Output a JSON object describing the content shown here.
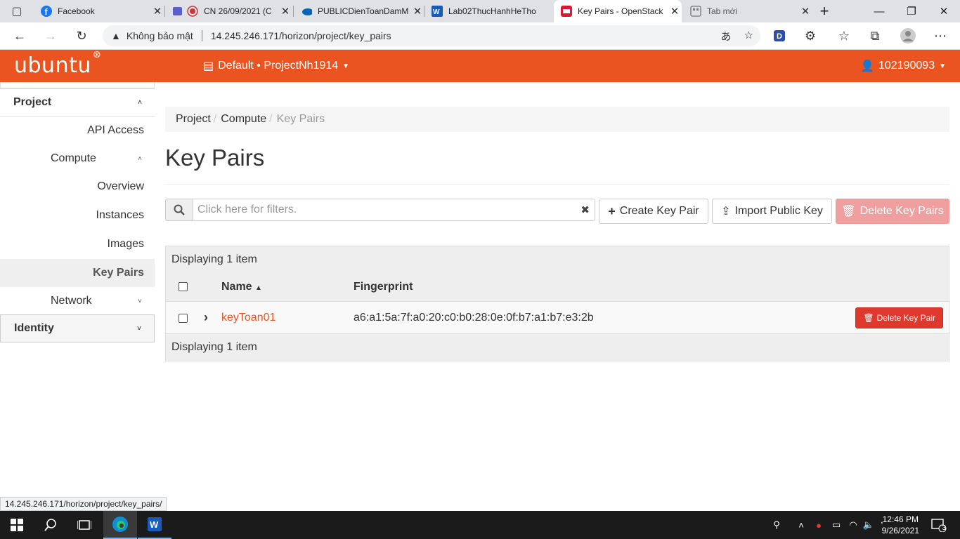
{
  "browser": {
    "tabs": [
      {
        "title": "Facebook",
        "icon": "facebook-icon"
      },
      {
        "title": "CN 26/09/2021 (C",
        "icon": "teams-record-icon"
      },
      {
        "title": "PUBLICDienToanDamM",
        "icon": "onedrive-icon"
      },
      {
        "title": "Lab02ThucHanhHeTho",
        "icon": "word-icon"
      },
      {
        "title": "Key Pairs - OpenStack",
        "icon": "openstack-icon",
        "active": true
      },
      {
        "title": "Tab mới",
        "icon": "newtab-icon"
      }
    ],
    "security_label": "Không bảo mật",
    "url": "14.245.246.171/horizon/project/key_pairs",
    "status_url": "14.245.246.171/horizon/project/key_pairs/"
  },
  "header": {
    "brand": "ubuntu",
    "project_selector": "Default • ProjectNh1914",
    "user": "102190093",
    "color": "#e95420"
  },
  "sidebar": {
    "project": "Project",
    "api_access": "API Access",
    "compute": "Compute",
    "overview": "Overview",
    "instances": "Instances",
    "images": "Images",
    "key_pairs": "Key Pairs",
    "network": "Network",
    "identity": "Identity"
  },
  "breadcrumb": {
    "project": "Project",
    "compute": "Compute",
    "current": "Key Pairs"
  },
  "page_title": "Key Pairs",
  "filter": {
    "placeholder": "Click here for filters."
  },
  "actions": {
    "create": "Create Key Pair",
    "import": "Import Public Key",
    "delete": "Delete Key Pairs"
  },
  "table": {
    "count_label": "Displaying 1 item",
    "columns": {
      "name": "Name",
      "fingerprint": "Fingerprint"
    },
    "rows": [
      {
        "name": "keyToan01",
        "fingerprint": "a6:a1:5a:7f:a0:20:c0:b0:28:0e:0f:b7:a1:b7:e3:2b",
        "action": "Delete Key Pair"
      }
    ]
  },
  "taskbar": {
    "time": "12:46 PM",
    "date": "9/26/2021",
    "notifications": "3"
  }
}
